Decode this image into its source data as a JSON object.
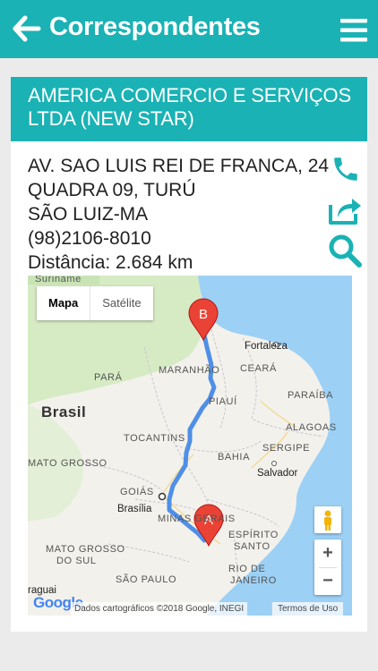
{
  "header": {
    "title": "Correspondentes",
    "back_icon": "arrow-left-icon",
    "menu_icon": "hamburger-menu-icon"
  },
  "correspondent": {
    "name": "AMERICA COMERCIO E SERVIÇOS LTDA (NEW STAR)",
    "address_line1": "AV. SAO LUIS REI DE FRANCA, 24",
    "address_line2": "QUADRA 09, TURÚ",
    "city": "SÃO LUIZ-MA",
    "phone": "(98)2106-8010",
    "distance": "Distância: 2.684 km"
  },
  "actions": {
    "call_icon": "phone-icon",
    "share_icon": "share-icon",
    "search_icon": "search-icon"
  },
  "map": {
    "type_options": [
      "Mapa",
      "Satélite"
    ],
    "selected_type": "Mapa",
    "marker_start": "A",
    "marker_end": "B",
    "labels": {
      "suriname": "Suriname",
      "brasil": "Brasil",
      "para": "PARÁ",
      "maranhao": "MARANHÃO",
      "ceara": "CEARÁ",
      "fortaleza": "Fortaleza",
      "piaui": "PIAUÍ",
      "paraiba": "PARAÍBA",
      "alagoas": "ALAGOAS",
      "sergipe": "SERGIPE",
      "tocantins": "TOCANTINS",
      "bahia": "BAHIA",
      "salvador": "Salvador",
      "mato_grosso": "MATO GROSSO",
      "goias": "GOIÁS",
      "brasilia": "Brasília",
      "minas_gerais": "MINAS GERAIS",
      "espirito_santo_1": "ESPÍRITO",
      "espirito_santo_2": "SANTO",
      "mato_grosso_do_sul_1": "MATO GROSSO",
      "mato_grosso_do_sul_2": "DO SUL",
      "rio_de_janeiro_1": "RIO DE",
      "rio_de_janeiro_2": "JANEIRO",
      "sao_paulo": "SÃO PAULO",
      "paraguai": "raguai"
    },
    "zoom_in": "+",
    "zoom_out": "−",
    "google_logo": "Google",
    "attribution": "Dados cartográficos ©2018 Google, INEGI",
    "terms": "Termos de Uso",
    "colors": {
      "route": "#4f8fe6",
      "marker": "#ea4335",
      "water": "#9cd0f5",
      "land": "#f3f1ec",
      "land_north": "#d9ecc8"
    }
  },
  "colors": {
    "primary": "#1ab2b4",
    "background": "#ebebeb"
  }
}
